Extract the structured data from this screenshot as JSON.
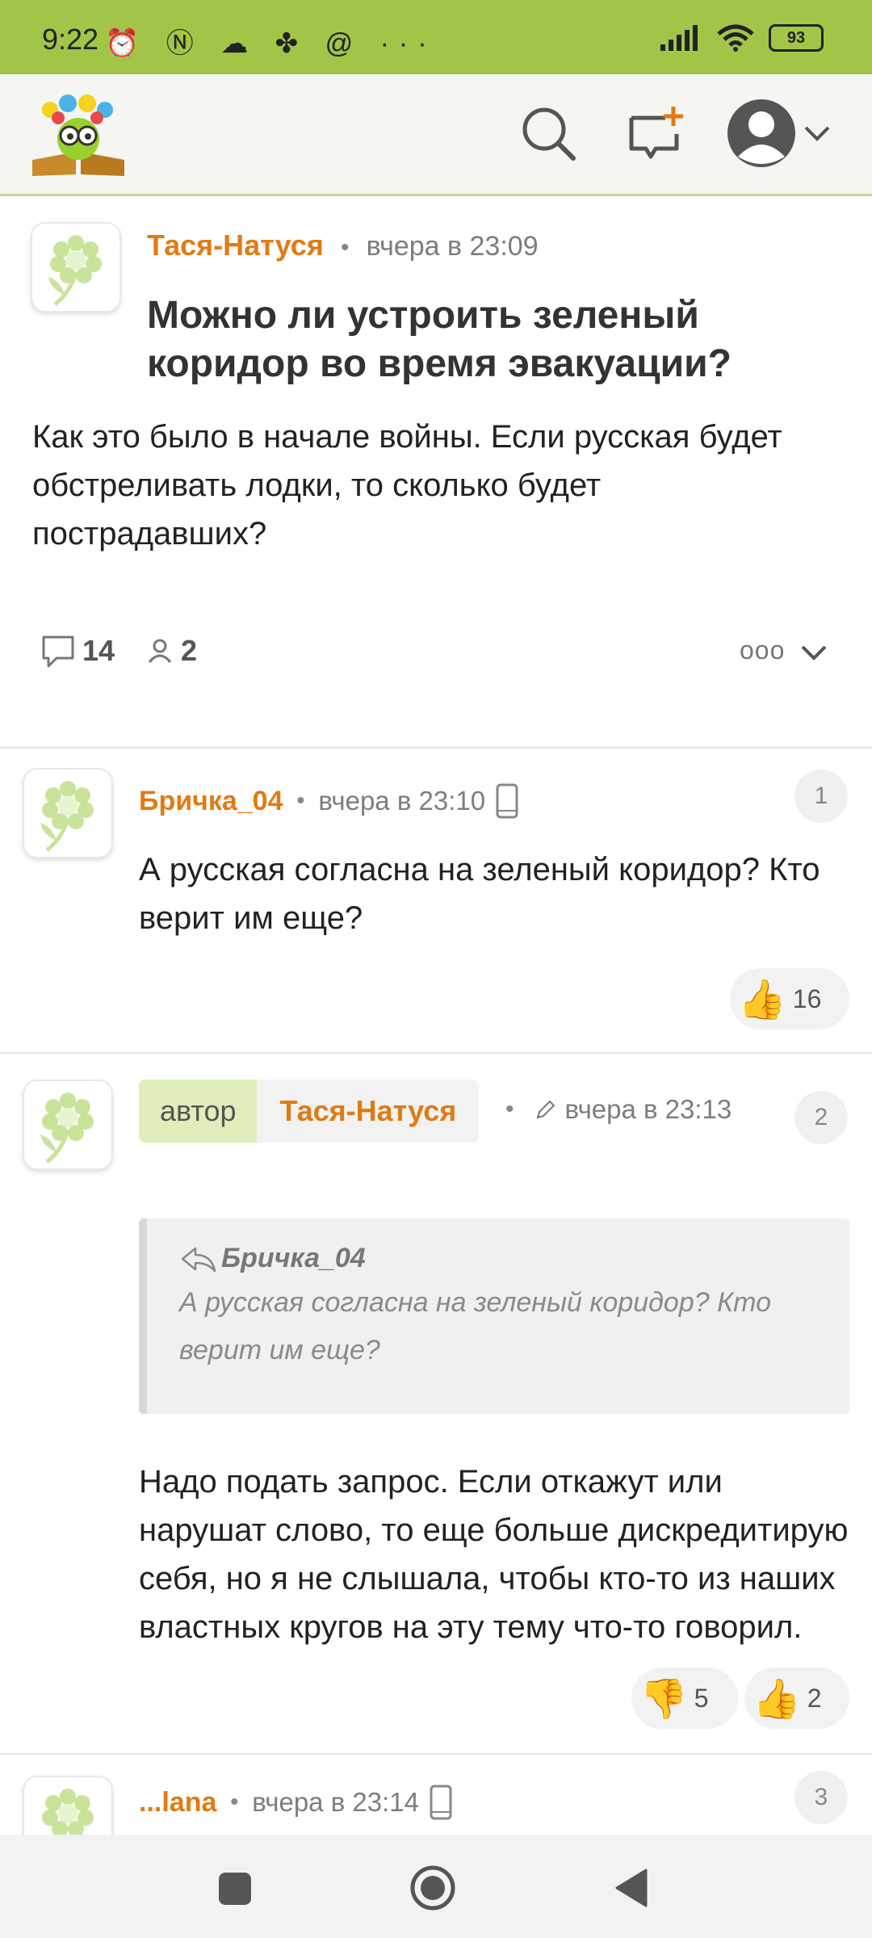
{
  "status_bar": {
    "time": "9:22",
    "left_icons": "⏰ Ⓝ ☁ ✤ @ ···",
    "battery": "93"
  },
  "post": {
    "author": "Тася-Натуся",
    "time": "вчера в 23:09",
    "title": "Можно ли устроить зеленый коридор во время эвакуации?",
    "body": "Как это было в начале войны. Если русская будет обстреливать лодки, то сколько будет пострадавших?",
    "comments_count": "14",
    "followers_count": "2",
    "more_label": "ooo"
  },
  "comments": [
    {
      "number": "1",
      "author": "Бричка_04",
      "time": "вчера в 23:10",
      "text": "А русская согласна на зеленый коридор? Кто верит им еще?",
      "likes": "16"
    },
    {
      "number": "2",
      "badge": "автор",
      "author": "Тася-Натуся",
      "time": "вчера в 23:13",
      "quote_author": "Бричка_04",
      "quote_text": "А русская согласна на зеленый коридор? Кто верит им еще?",
      "text": "Надо подать запрос. Если откажут или нарушат слово, то еще больше дискредитирую себя, но я не слышала, чтобы кто-то из наших властных кругов на эту тему что-то говорил.",
      "dislikes": "5",
      "likes": "2"
    },
    {
      "number": "3",
      "author": "...lana",
      "time": "вчера в 23:14"
    }
  ],
  "colors": {
    "brand_green": "#a2c548",
    "author_orange": "#e07b14"
  }
}
